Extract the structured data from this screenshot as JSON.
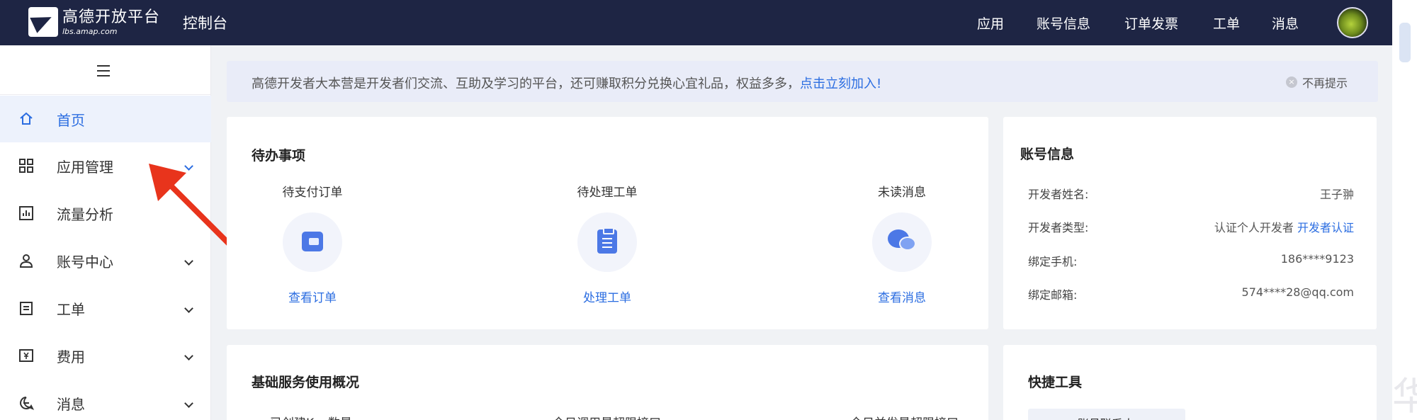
{
  "header": {
    "logo_name": "高德开放平台",
    "logo_url": "lbs.amap.com",
    "section": "控制台",
    "nav": [
      "应用",
      "账号信息",
      "订单发票",
      "工单",
      "消息"
    ]
  },
  "sidebar": {
    "items": [
      {
        "label": "首页",
        "icon": "home-icon",
        "active": true
      },
      {
        "label": "应用管理",
        "icon": "grid-icon"
      },
      {
        "label": "流量分析",
        "icon": "chart-icon"
      },
      {
        "label": "账号中心",
        "icon": "user-icon"
      },
      {
        "label": "工单",
        "icon": "ticket-icon"
      },
      {
        "label": "费用",
        "icon": "yen-icon"
      },
      {
        "label": "消息",
        "icon": "chat-icon"
      }
    ]
  },
  "banner": {
    "text": "高德开发者大本营是开发者们交流、互助及学习的平台，还可赚取积分兑换心宜礼品，权益多多，",
    "link": "点击立刻加入!",
    "close": "不再提示"
  },
  "todo": {
    "title": "待办事项",
    "items": [
      {
        "head": "待支付订单",
        "link": "查看订单",
        "icon": "wallet-icon"
      },
      {
        "head": "待处理工单",
        "link": "处理工单",
        "icon": "clipboard-icon"
      },
      {
        "head": "未读消息",
        "link": "查看消息",
        "icon": "chat-bubble-icon"
      }
    ]
  },
  "account": {
    "title": "账号信息",
    "rows": [
      {
        "label": "开发者姓名:",
        "value": "王子翀"
      },
      {
        "label": "开发者类型:",
        "value": "认证个人开发者",
        "link": "开发者认证"
      },
      {
        "label": "绑定手机:",
        "value": "186****9123"
      },
      {
        "label": "绑定邮箱:",
        "value": "574****28@qq.com"
      }
    ]
  },
  "usage": {
    "title": "基础服务使用概况",
    "subs": [
      "已创建Key数量",
      "今日调用量超限接口",
      "今日并发量超限接口"
    ]
  },
  "quick": {
    "title": "快捷工具",
    "first": "账号联系人"
  },
  "watermark": "华",
  "colors": {
    "accent": "#2b6de1",
    "header_bg": "#1e2544",
    "arrow": "#e8341c"
  }
}
